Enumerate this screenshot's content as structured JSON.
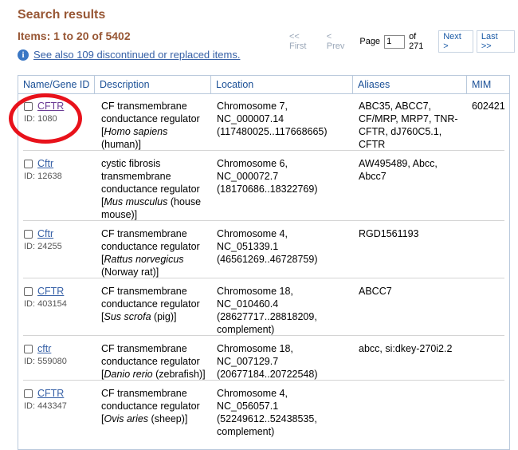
{
  "header": {
    "title": "Search results",
    "items_summary": "Items: 1 to 20 of 5402"
  },
  "pager": {
    "first": "<< First",
    "prev": "< Prev",
    "page_label": "Page",
    "page_value": "1",
    "of_total": "of 271",
    "next": "Next >",
    "last": "Last >>"
  },
  "notice": {
    "link": "See also 109 discontinued or replaced items."
  },
  "table": {
    "columns": [
      "Name/Gene ID",
      "Description",
      "Location",
      "Aliases",
      "MIM"
    ],
    "rows": [
      {
        "name": "CFTR",
        "id": "ID: 1080",
        "desc": [
          "CF transmembrane",
          "conductance regulator",
          "[Homo sapiens",
          "(human)]"
        ],
        "loc": [
          "Chromosome 7,",
          "NC_000007.14",
          "(117480025..117668665)"
        ],
        "aliases": [
          "ABC35, ABCC7,",
          "CF/MRP, MRP7, TNR-",
          "CFTR, dJ760C5.1,",
          "CFTR"
        ],
        "mim": "602421"
      },
      {
        "name": "Cftr",
        "id": "ID: 12638",
        "desc": [
          "cystic fibrosis",
          "transmembrane",
          "conductance regulator",
          "[Mus musculus (house",
          "mouse)]"
        ],
        "loc": [
          "Chromosome 6,",
          "NC_000072.7",
          "(18170686..18322769)"
        ],
        "aliases": [
          "AW495489, Abcc,",
          "Abcc7"
        ],
        "mim": ""
      },
      {
        "name": "Cftr",
        "id": "ID: 24255",
        "desc": [
          "CF transmembrane",
          "conductance regulator",
          "[Rattus norvegicus",
          "(Norway rat)]"
        ],
        "loc": [
          "Chromosome 4,",
          "NC_051339.1",
          "(46561269..46728759)"
        ],
        "aliases": [
          "RGD1561193"
        ],
        "mim": ""
      },
      {
        "name": "CFTR",
        "id": "ID: 403154",
        "desc": [
          "CF transmembrane",
          "conductance regulator",
          "[Sus scrofa (pig)]"
        ],
        "loc": [
          "Chromosome 18,",
          "NC_010460.4",
          "(28627717..28818209,",
          "complement)"
        ],
        "aliases": [
          "ABCC7"
        ],
        "mim": ""
      },
      {
        "name": "cftr",
        "id": "ID: 559080",
        "desc": [
          "CF transmembrane",
          "conductance regulator",
          "[Danio rerio (zebrafish)]"
        ],
        "loc": [
          "Chromosome 18,",
          "NC_007129.7",
          "(20677184..20722548)"
        ],
        "aliases": [
          "abcc, si:dkey-270i2.2"
        ],
        "mim": ""
      },
      {
        "name": "CFTR",
        "id": "ID: 443347",
        "desc": [
          "CF transmembrane",
          "conductance regulator",
          "[Ovis aries (sheep)]"
        ],
        "loc": [
          "Chromosome 4,",
          "NC_056057.1",
          "(52249612..52438535,",
          "complement)"
        ],
        "aliases": [
          ""
        ],
        "mim": ""
      }
    ]
  },
  "colors": {
    "heading": "#985735",
    "link": "#3660a6",
    "visited_link": "#6b3c95",
    "highlight_circle": "#e8121b",
    "table_border": "#b9c9dc"
  }
}
